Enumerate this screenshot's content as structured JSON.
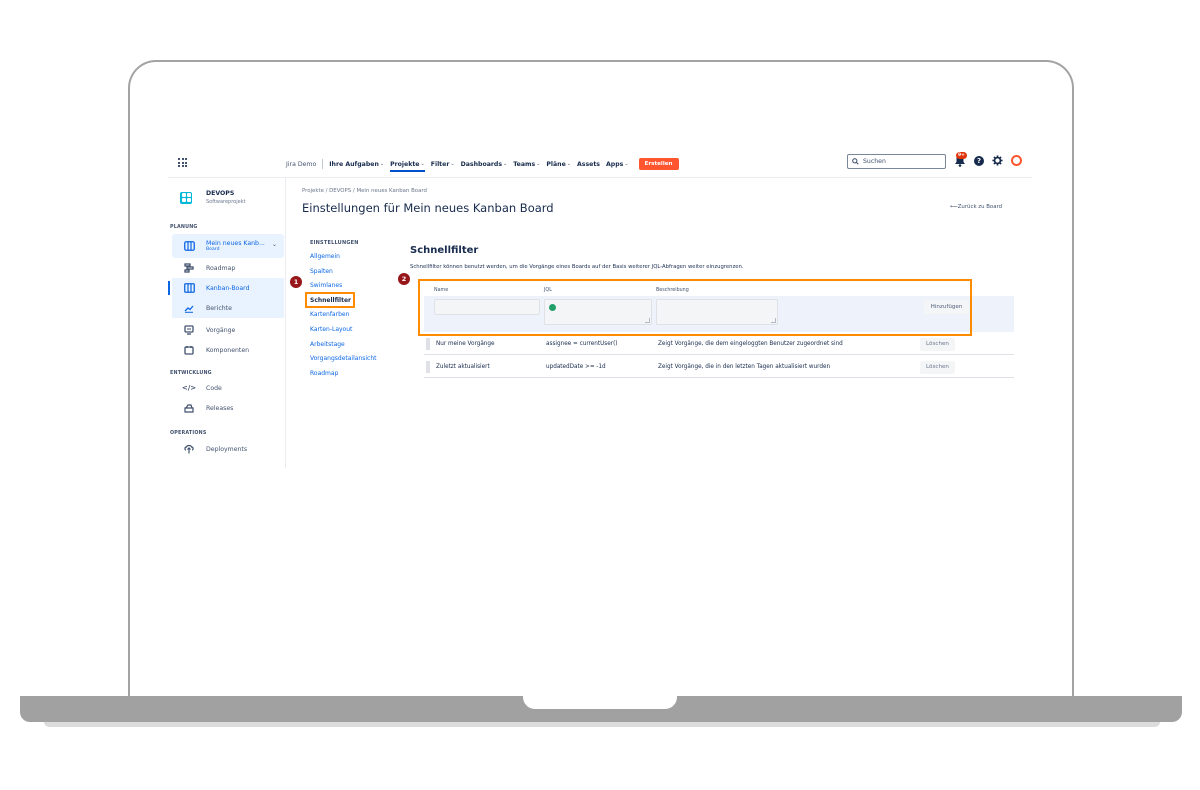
{
  "nav": {
    "site": "Jira Demo",
    "items": [
      {
        "label": "Ihre Aufgaben",
        "chevron": true
      },
      {
        "label": "Projekte",
        "chevron": true
      },
      {
        "label": "Filter",
        "chevron": true
      },
      {
        "label": "Dashboards",
        "chevron": true
      },
      {
        "label": "Teams",
        "chevron": true
      },
      {
        "label": "Pläne",
        "chevron": true
      },
      {
        "label": "Assets",
        "chevron": false
      },
      {
        "label": "Apps",
        "chevron": true
      }
    ],
    "create_label": "Erstellen",
    "search_placeholder": "Suchen",
    "notification_badge": "9+",
    "help_glyph": "?"
  },
  "sidebar": {
    "project_name": "DEVOPS",
    "project_type": "Softwareprojekt",
    "section_planning": "PLANUNG",
    "board_name": "Mein neues Kanb...",
    "board_sub": "Board",
    "planning_items": [
      {
        "label": "Roadmap",
        "icon": "roadmap-icon"
      },
      {
        "label": "Kanban-Board",
        "icon": "kanban-icon"
      },
      {
        "label": "Berichte",
        "icon": "reports-icon"
      }
    ],
    "other_items": [
      {
        "label": "Vorgänge",
        "icon": "issues-icon"
      },
      {
        "label": "Komponenten",
        "icon": "components-icon"
      }
    ],
    "section_development": "ENTWICKLUNG",
    "development_items": [
      {
        "label": "Code",
        "icon": "code-icon"
      },
      {
        "label": "Releases",
        "icon": "releases-icon"
      }
    ],
    "section_operations": "OPERATIONS",
    "operations_items": [
      {
        "label": "Deployments",
        "icon": "deployments-icon"
      }
    ]
  },
  "header": {
    "breadcrumb": "Projekte  /  DEVOPS  /  Mein neues Kanban Board",
    "title": "Einstellungen für Mein neues Kanban Board",
    "back_link": "Zurück zu Board"
  },
  "settings": {
    "heading": "EINSTELLUNGEN",
    "items": [
      "Allgemein",
      "Spalten",
      "Swimlanes",
      "Schnellfilter",
      "Kartenfarben",
      "Karten-Layout",
      "Arbeitstage",
      "Vorgangsdetailansicht",
      "Roadmap"
    ],
    "current": "Schnellfilter"
  },
  "markers": {
    "one": "1",
    "two": "2"
  },
  "quick_filters": {
    "title": "Schnellfilter",
    "description": "Schnellfilter können benutzt werden, um die Vorgänge eines Boards auf der Basis weiterer JQL-Abfragen weiter einzugrenzen.",
    "columns": {
      "name": "Name",
      "jql": "JQL",
      "description": "Beschreibung"
    },
    "add_label": "Hinzufügen",
    "rows": [
      {
        "name": "Nur meine Vorgänge",
        "jql": "assignee = currentUser()",
        "description": "Zeigt Vorgänge, die dem eingeloggten Benutzer zugeordnet sind",
        "action": "Löschen"
      },
      {
        "name": "Zuletzt aktualisiert",
        "jql": "updatedDate >= -1d",
        "description": "Zeigt Vorgänge, die in den letzten Tagen aktualisiert wurden",
        "action": "Löschen"
      }
    ]
  },
  "colors": {
    "accent": "#0c66e4",
    "highlight": "#ff8b00",
    "marker": "#97161a",
    "create": "#ff5630"
  }
}
